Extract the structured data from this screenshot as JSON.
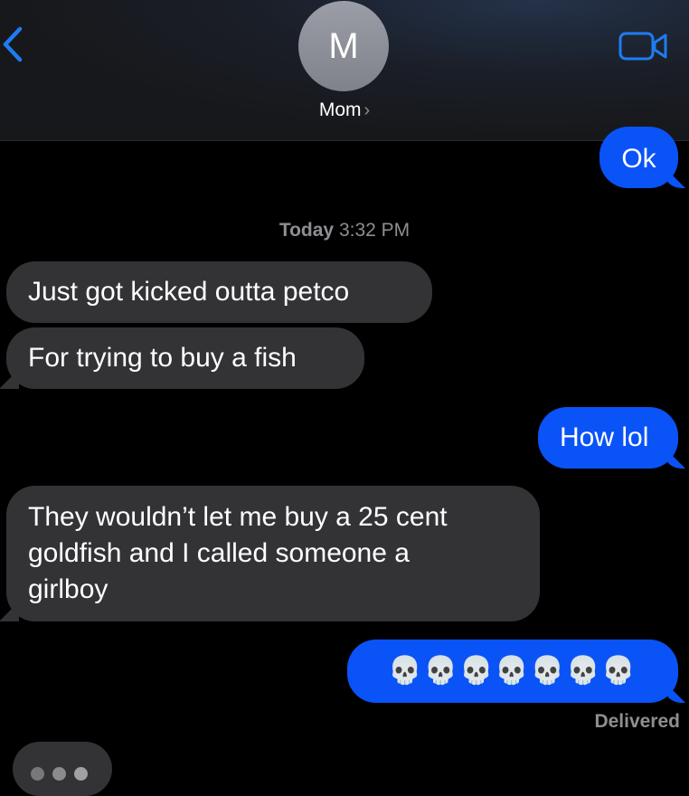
{
  "header": {
    "avatar_initial": "M",
    "contact_name": "Mom",
    "chevron": "›",
    "back_icon": "chevron-left",
    "video_icon": "video-camera"
  },
  "timestamp": {
    "day": "Today",
    "time": "3:32 PM"
  },
  "messages": [
    {
      "dir": "out",
      "text": "Ok"
    },
    {
      "dir": "in",
      "text": "Just got kicked outta petco"
    },
    {
      "dir": "in",
      "text": "For trying to buy a fish"
    },
    {
      "dir": "out",
      "text": "How lol"
    },
    {
      "dir": "in",
      "lines": [
        "They wouldn’t let me buy a 25 cent",
        "goldfish and I called someone a",
        "girlboy"
      ]
    },
    {
      "dir": "out",
      "text": "💀💀💀💀💀💀💀"
    }
  ],
  "status": "Delivered",
  "colors": {
    "outgoing": "#0a53f7",
    "incoming": "#333336",
    "accent": "#1e7cf2"
  }
}
